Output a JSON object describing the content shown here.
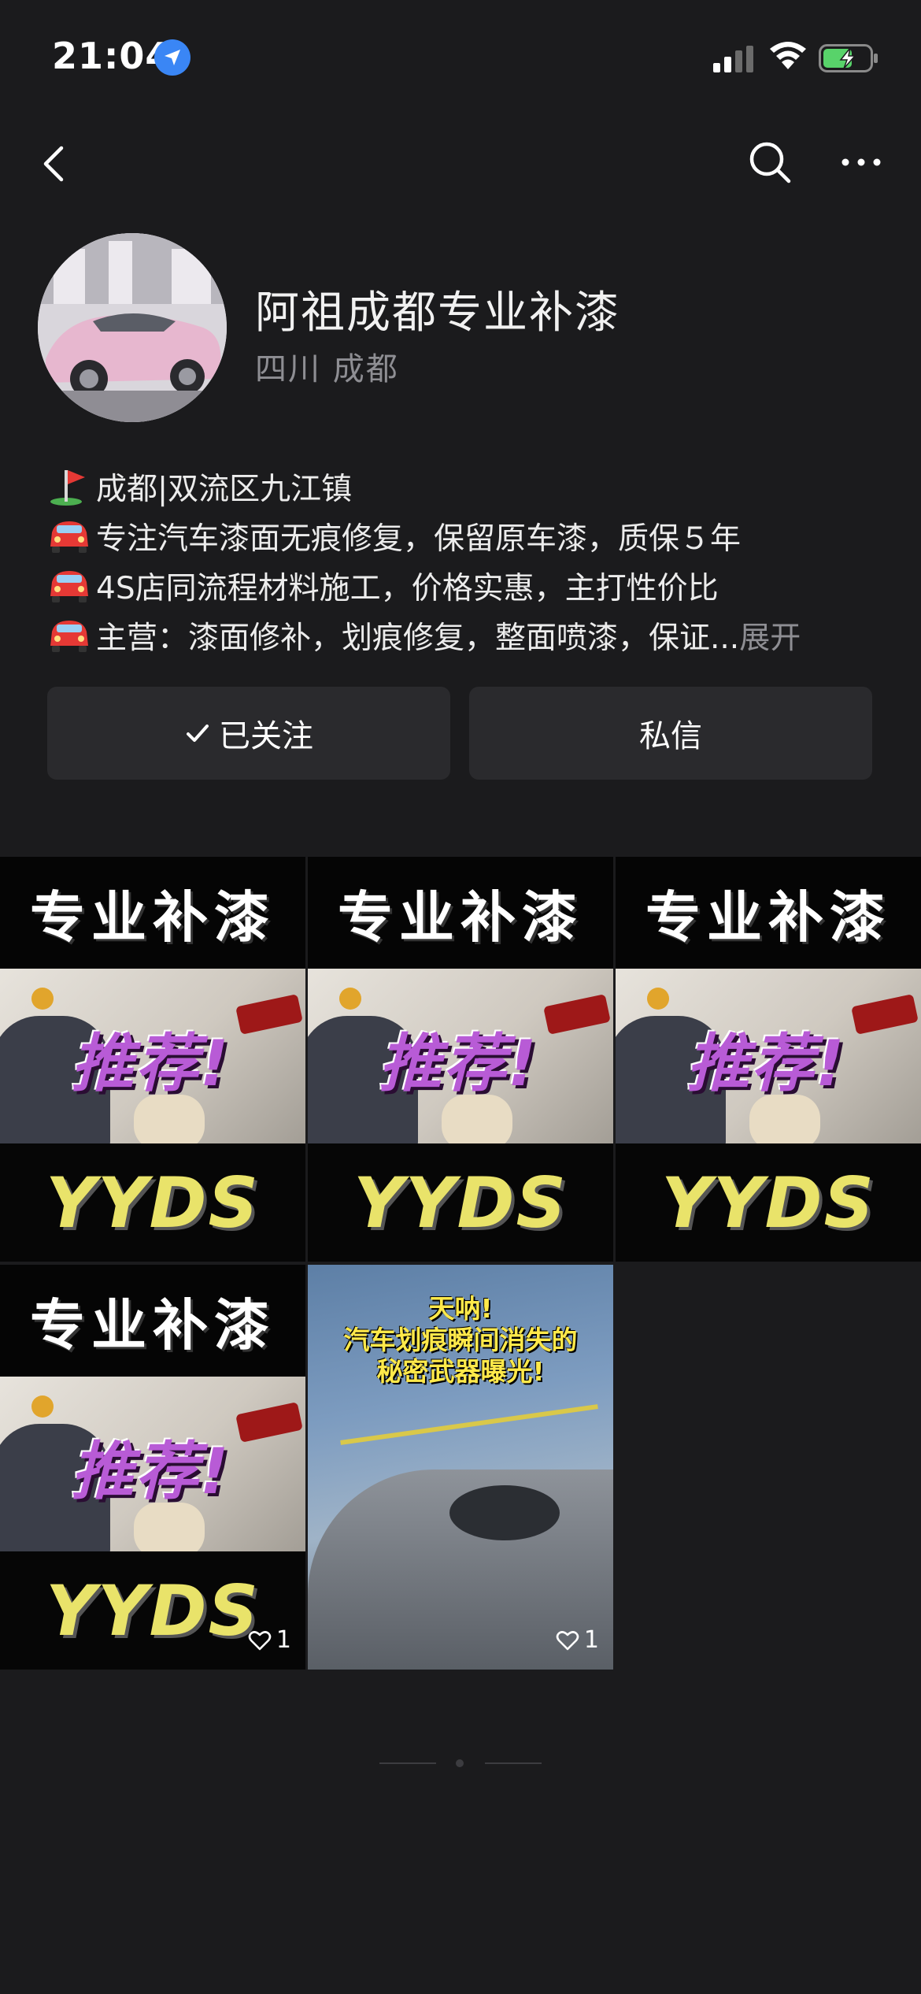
{
  "status_bar": {
    "time": "21:04"
  },
  "profile": {
    "name": "阿祖成都专业补漆",
    "location": "四川 成都",
    "bio": [
      {
        "icon": "golf-flag-icon",
        "text": "成都|双流区九江镇"
      },
      {
        "icon": "car-icon",
        "text": "专注汽车漆面无痕修复，保留原车漆，质保５年"
      },
      {
        "icon": "car-icon",
        "text": "4S店同流程材料施工，价格实惠，主打性价比"
      },
      {
        "icon": "car-icon",
        "text": "主营：漆面修补，划痕修复，整面喷漆，保证..."
      }
    ],
    "expand_label": "展开"
  },
  "actions": {
    "follow_label": "已关注",
    "message_label": "私信"
  },
  "posts": [
    {
      "top": "专业补漆",
      "mid": "推荐!",
      "bottom": "YYDS",
      "likes": ""
    },
    {
      "top": "专业补漆",
      "mid": "推荐!",
      "bottom": "YYDS",
      "likes": ""
    },
    {
      "top": "专业补漆",
      "mid": "推荐!",
      "bottom": "YYDS",
      "likes": ""
    },
    {
      "top": "专业补漆",
      "mid": "推荐!",
      "bottom": "YYDS",
      "likes": "1"
    },
    {
      "caption_1": "天呐!",
      "caption_2": "汽车划痕瞬间消失的",
      "caption_3": "秘密武器曝光!",
      "likes": "1"
    }
  ]
}
